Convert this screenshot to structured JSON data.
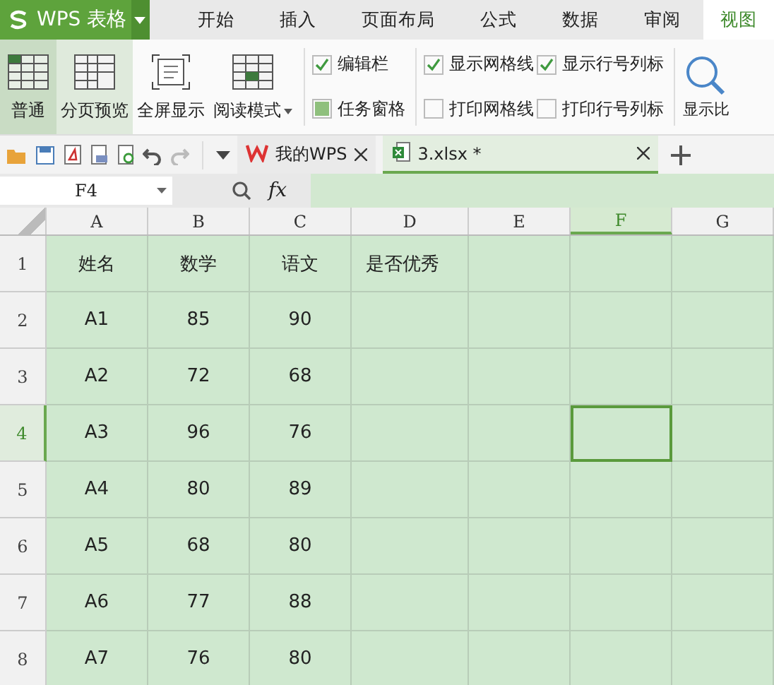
{
  "app": {
    "title": "WPS 表格"
  },
  "menu_tabs": [
    {
      "label": "开始",
      "selected": false
    },
    {
      "label": "插入",
      "selected": false
    },
    {
      "label": "页面布局",
      "selected": false
    },
    {
      "label": "公式",
      "selected": false
    },
    {
      "label": "数据",
      "selected": false
    },
    {
      "label": "审阅",
      "selected": false
    },
    {
      "label": "视图",
      "selected": true
    }
  ],
  "ribbon": {
    "view_buttons": [
      {
        "label": "普通",
        "kind": "normal",
        "selected": true
      },
      {
        "label": "分页预览",
        "kind": "pagebreak",
        "selected": false
      },
      {
        "label": "全屏显示",
        "kind": "fullscreen",
        "selected": false
      },
      {
        "label": "阅读模式",
        "kind": "reading",
        "selected": false,
        "dropdown": true
      }
    ],
    "checkbox_groups": [
      [
        {
          "label": "编辑栏",
          "checked": true,
          "kind": "tick"
        },
        {
          "label": "任务窗格",
          "checked": true,
          "kind": "square"
        }
      ],
      [
        {
          "label": "显示网格线",
          "checked": true,
          "kind": "tick"
        },
        {
          "label": "打印网格线",
          "checked": false,
          "kind": "tick"
        }
      ],
      [
        {
          "label": "显示行号列标",
          "checked": true,
          "kind": "tick"
        },
        {
          "label": "打印行号列标",
          "checked": false,
          "kind": "tick"
        }
      ]
    ],
    "zoom_button": {
      "label": "显示比"
    }
  },
  "doc_tabs": [
    {
      "label": "我的WPS",
      "kind": "home",
      "selected": false
    },
    {
      "label": "3.xlsx *",
      "kind": "sheet",
      "selected": true
    }
  ],
  "formula_bar": {
    "name_box": "F4",
    "fx": "fx"
  },
  "columns": [
    {
      "label": "A",
      "selected": false
    },
    {
      "label": "B",
      "selected": false
    },
    {
      "label": "C",
      "selected": false
    },
    {
      "label": "D",
      "selected": false
    },
    {
      "label": "E",
      "selected": false
    },
    {
      "label": "F",
      "selected": true
    },
    {
      "label": "G",
      "selected": false
    }
  ],
  "rows": [
    {
      "number": "1",
      "selected": false,
      "cells": [
        "姓名",
        "数学",
        "语文",
        "是否优秀"
      ]
    },
    {
      "number": "2",
      "selected": false,
      "cells": [
        "A1",
        "85",
        "90"
      ]
    },
    {
      "number": "3",
      "selected": false,
      "cells": [
        "A2",
        "72",
        "68"
      ]
    },
    {
      "number": "4",
      "selected": true,
      "cells": [
        "A3",
        "96",
        "76"
      ]
    },
    {
      "number": "5",
      "selected": false,
      "cells": [
        "A4",
        "80",
        "89"
      ]
    },
    {
      "number": "6",
      "selected": false,
      "cells": [
        "A5",
        "68",
        "80"
      ]
    },
    {
      "number": "7",
      "selected": false,
      "cells": [
        "A6",
        "77",
        "88"
      ]
    },
    {
      "number": "8",
      "selected": false,
      "cells": [
        "A7",
        "76",
        "80"
      ]
    }
  ]
}
